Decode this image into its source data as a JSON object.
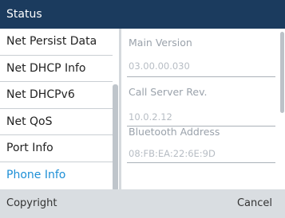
{
  "title": "Status",
  "menu": {
    "items": [
      {
        "label": "Net Persist Data",
        "selected": false
      },
      {
        "label": "Net DHCP Info",
        "selected": false
      },
      {
        "label": "Net DHCPv6",
        "selected": false
      },
      {
        "label": "Net QoS",
        "selected": false
      },
      {
        "label": "Port Info",
        "selected": false
      },
      {
        "label": "Phone Info",
        "selected": true
      }
    ]
  },
  "details": {
    "main_version_label": "Main Version",
    "main_version_value": "03.00.00.030",
    "call_server_label": "Call Server Rev.",
    "call_server_value": "10.0.2.12",
    "bluetooth_label": "Bluetooth Address",
    "bluetooth_value": "08:FB:EA:22:6E:9D"
  },
  "softkeys": {
    "left": "Copyright",
    "right": "Cancel"
  },
  "colors": {
    "title_bg": "#1b3b5e",
    "selected_text": "#1d8fd6",
    "softkey_bg": "#d9dde1"
  }
}
